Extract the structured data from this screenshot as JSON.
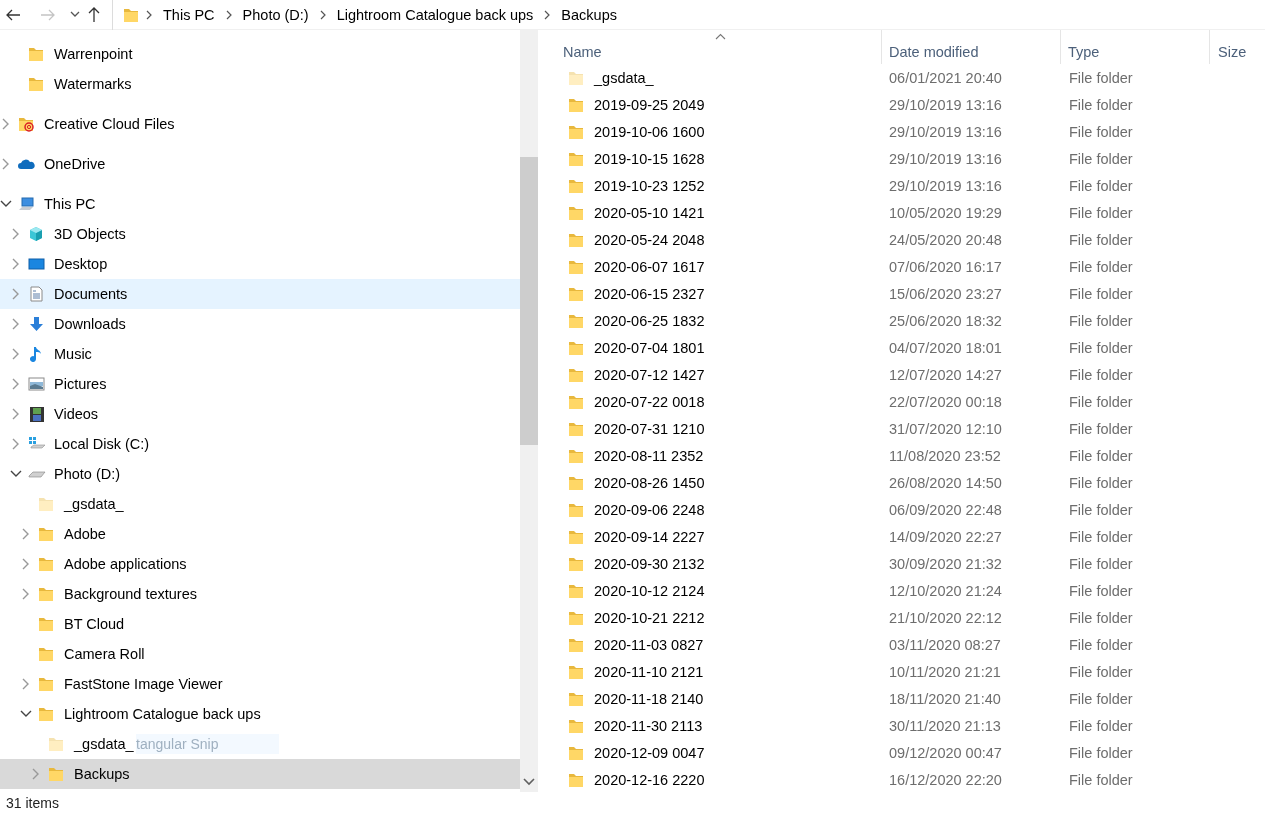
{
  "nav": {
    "back_enabled": true,
    "forward_enabled": false
  },
  "address": {
    "crumbs": [
      "This PC",
      "Photo (D:)",
      "Lightroom Catalogue back ups",
      "Backups"
    ]
  },
  "tree": {
    "partial_branch": [
      {
        "label": "Warrenpoint",
        "kind": "folder",
        "selected": false,
        "hovered": false
      },
      {
        "label": "Watermarks",
        "kind": "folder",
        "selected": false,
        "hovered": false
      }
    ],
    "items": [
      {
        "label": "Creative Cloud Files",
        "kind": "cc-folder",
        "expanded": false,
        "selected": false,
        "hovered": false
      },
      {
        "label": "OneDrive",
        "kind": "cloud",
        "expanded": false,
        "selected": false,
        "hovered": false
      },
      {
        "label": "This PC",
        "kind": "computer",
        "expanded": true,
        "selected": false,
        "hovered": false,
        "children": [
          {
            "label": "3D Objects",
            "kind": "cube",
            "expanded": false,
            "selected": false,
            "hovered": false
          },
          {
            "label": "Desktop",
            "kind": "desktop",
            "expanded": false,
            "selected": false,
            "hovered": false
          },
          {
            "label": "Documents",
            "kind": "document",
            "expanded": false,
            "selected": false,
            "hovered": true
          },
          {
            "label": "Downloads",
            "kind": "download",
            "expanded": false,
            "selected": false,
            "hovered": false
          },
          {
            "label": "Music",
            "kind": "music",
            "expanded": false,
            "selected": false,
            "hovered": false
          },
          {
            "label": "Pictures",
            "kind": "pictures",
            "expanded": false,
            "selected": false,
            "hovered": false
          },
          {
            "label": "Videos",
            "kind": "videos",
            "expanded": false,
            "selected": false,
            "hovered": false
          },
          {
            "label": "Local Disk (C:)",
            "kind": "windows-drive",
            "expanded": false,
            "selected": false,
            "hovered": false
          },
          {
            "label": "Photo (D:)",
            "kind": "drive",
            "expanded": true,
            "selected": false,
            "hovered": false,
            "children": [
              {
                "label": "_gsdata_",
                "kind": "folder",
                "hidden": true,
                "selected": false,
                "hovered": false
              },
              {
                "label": "Adobe",
                "kind": "folder",
                "expanded": false,
                "selected": false,
                "hovered": false
              },
              {
                "label": "Adobe applications",
                "kind": "folder",
                "expanded": false,
                "selected": false,
                "hovered": false
              },
              {
                "label": "Background textures",
                "kind": "folder",
                "expanded": false,
                "selected": false,
                "hovered": false
              },
              {
                "label": "BT Cloud",
                "kind": "folder",
                "selected": false,
                "hovered": false
              },
              {
                "label": "Camera Roll",
                "kind": "folder",
                "selected": false,
                "hovered": false
              },
              {
                "label": "FastStone Image Viewer",
                "kind": "folder",
                "expanded": false,
                "selected": false,
                "hovered": false
              },
              {
                "label": "Lightroom Catalogue back ups",
                "kind": "folder",
                "expanded": true,
                "selected": false,
                "hovered": false,
                "children": [
                  {
                    "label": "_gsdata_",
                    "kind": "folder",
                    "hidden": true,
                    "selected": false,
                    "hovered": false,
                    "ghost_text": "tangular Snip"
                  },
                  {
                    "label": "Backups",
                    "kind": "folder",
                    "expanded": false,
                    "selected": true,
                    "hovered": false
                  }
                ]
              }
            ]
          }
        ]
      }
    ]
  },
  "table": {
    "columns": [
      {
        "label": "Name",
        "sorted": true
      },
      {
        "label": "Date modified",
        "sorted": false
      },
      {
        "label": "Type",
        "sorted": false
      },
      {
        "label": "Size",
        "sorted": false
      }
    ],
    "rows": [
      {
        "name": "_gsdata_",
        "hidden": true,
        "date": "06/01/2021 20:40",
        "type": "File folder"
      },
      {
        "name": "2019-09-25 2049",
        "hidden": false,
        "date": "29/10/2019 13:16",
        "type": "File folder"
      },
      {
        "name": "2019-10-06 1600",
        "hidden": false,
        "date": "29/10/2019 13:16",
        "type": "File folder"
      },
      {
        "name": "2019-10-15 1628",
        "hidden": false,
        "date": "29/10/2019 13:16",
        "type": "File folder"
      },
      {
        "name": "2019-10-23 1252",
        "hidden": false,
        "date": "29/10/2019 13:16",
        "type": "File folder"
      },
      {
        "name": "2020-05-10 1421",
        "hidden": false,
        "date": "10/05/2020 19:29",
        "type": "File folder"
      },
      {
        "name": "2020-05-24 2048",
        "hidden": false,
        "date": "24/05/2020 20:48",
        "type": "File folder"
      },
      {
        "name": "2020-06-07 1617",
        "hidden": false,
        "date": "07/06/2020 16:17",
        "type": "File folder"
      },
      {
        "name": "2020-06-15 2327",
        "hidden": false,
        "date": "15/06/2020 23:27",
        "type": "File folder"
      },
      {
        "name": "2020-06-25 1832",
        "hidden": false,
        "date": "25/06/2020 18:32",
        "type": "File folder"
      },
      {
        "name": "2020-07-04 1801",
        "hidden": false,
        "date": "04/07/2020 18:01",
        "type": "File folder"
      },
      {
        "name": "2020-07-12 1427",
        "hidden": false,
        "date": "12/07/2020 14:27",
        "type": "File folder"
      },
      {
        "name": "2020-07-22 0018",
        "hidden": false,
        "date": "22/07/2020 00:18",
        "type": "File folder"
      },
      {
        "name": "2020-07-31 1210",
        "hidden": false,
        "date": "31/07/2020 12:10",
        "type": "File folder"
      },
      {
        "name": "2020-08-11 2352",
        "hidden": false,
        "date": "11/08/2020 23:52",
        "type": "File folder"
      },
      {
        "name": "2020-08-26 1450",
        "hidden": false,
        "date": "26/08/2020 14:50",
        "type": "File folder"
      },
      {
        "name": "2020-09-06 2248",
        "hidden": false,
        "date": "06/09/2020 22:48",
        "type": "File folder"
      },
      {
        "name": "2020-09-14 2227",
        "hidden": false,
        "date": "14/09/2020 22:27",
        "type": "File folder"
      },
      {
        "name": "2020-09-30 2132",
        "hidden": false,
        "date": "30/09/2020 21:32",
        "type": "File folder"
      },
      {
        "name": "2020-10-12 2124",
        "hidden": false,
        "date": "12/10/2020 21:24",
        "type": "File folder"
      },
      {
        "name": "2020-10-21 2212",
        "hidden": false,
        "date": "21/10/2020 22:12",
        "type": "File folder"
      },
      {
        "name": "2020-11-03 0827",
        "hidden": false,
        "date": "03/11/2020 08:27",
        "type": "File folder"
      },
      {
        "name": "2020-11-10 2121",
        "hidden": false,
        "date": "10/11/2020 21:21",
        "type": "File folder"
      },
      {
        "name": "2020-11-18 2140",
        "hidden": false,
        "date": "18/11/2020 21:40",
        "type": "File folder"
      },
      {
        "name": "2020-11-30 2113",
        "hidden": false,
        "date": "30/11/2020 21:13",
        "type": "File folder"
      },
      {
        "name": "2020-12-09 0047",
        "hidden": false,
        "date": "09/12/2020 00:47",
        "type": "File folder"
      },
      {
        "name": "2020-12-16 2220",
        "hidden": false,
        "date": "16/12/2020 22:20",
        "type": "File folder"
      }
    ]
  },
  "status_bar": {
    "item_count": "31 items"
  }
}
